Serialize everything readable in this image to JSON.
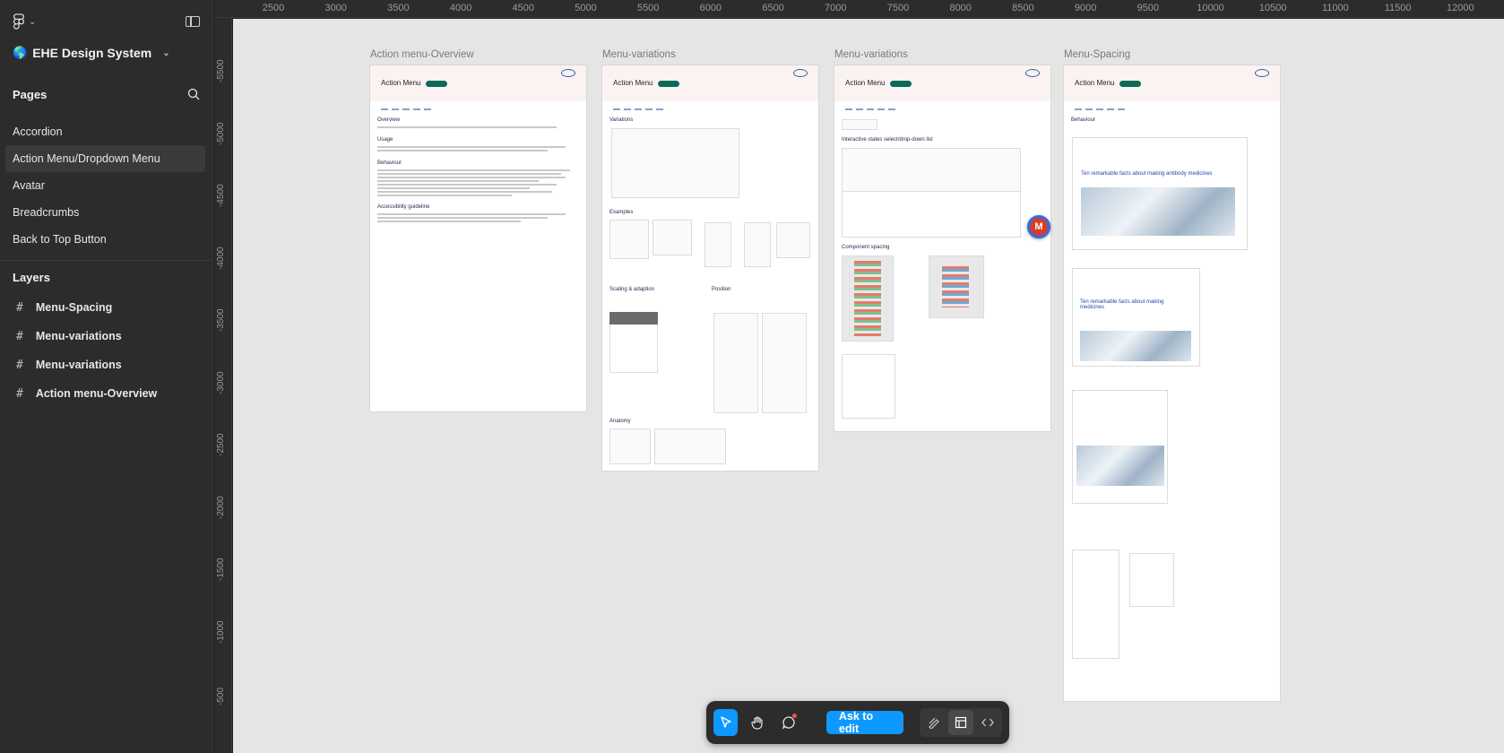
{
  "file": {
    "name": "EHE Design System",
    "emoji": "🌎"
  },
  "sidebar": {
    "pages_heading": "Pages",
    "pages": [
      {
        "label": "Accordion"
      },
      {
        "label": "Action Menu/Dropdown Menu"
      },
      {
        "label": "Avatar"
      },
      {
        "label": "Breadcrumbs"
      },
      {
        "label": "Back to Top Button"
      }
    ],
    "active_page": "Action Menu/Dropdown Menu",
    "layers_heading": "Layers",
    "layers": [
      {
        "label": "Menu-Spacing"
      },
      {
        "label": "Menu-variations"
      },
      {
        "label": "Menu-variations"
      },
      {
        "label": "Action menu-Overview"
      }
    ]
  },
  "ruler": {
    "x_ticks": [
      "2500",
      "3000",
      "3500",
      "4000",
      "4500",
      "5000",
      "5500",
      "6000",
      "6500",
      "7000",
      "7500",
      "8000",
      "8500",
      "9000",
      "9500",
      "10000",
      "10500",
      "11000",
      "11500",
      "12000"
    ],
    "y_ticks": [
      "-5500",
      "-5000",
      "-4500",
      "-4000",
      "-3500",
      "-3000",
      "-2500",
      "-2000",
      "-1500",
      "-1000",
      "-500"
    ]
  },
  "frames": [
    {
      "label": "Action menu-Overview",
      "heading": "Action Menu",
      "sections": [
        "Overview",
        "Usage",
        "Behaviour",
        "Accessibility guideline"
      ]
    },
    {
      "label": "Menu-variations",
      "heading": "Action Menu",
      "sections": [
        "Variations",
        "Examples",
        "Scaling & adaption",
        "Position",
        "Anatomy"
      ]
    },
    {
      "label": "Menu-variations",
      "heading": "Action Menu",
      "sections": [
        "Interactive states select/drop-down list",
        "Component spacing"
      ]
    },
    {
      "label": "Menu-Spacing",
      "heading": "Action Menu",
      "sections": [
        "Behaviour"
      ],
      "article_title": "Ten remarkable facts about making antibody medicines",
      "article_title_short": "Ten remarkable facts about making medicines"
    }
  ],
  "collaborator": {
    "initial": "M",
    "color": "#d93b2b",
    "ring": "#2a6ee8"
  },
  "toolbar": {
    "ask_label": "Ask to edit",
    "tools": [
      "move-icon",
      "hand-icon",
      "comment-icon"
    ],
    "modes": [
      "draw-icon",
      "design-icon",
      "code-icon"
    ]
  },
  "colors": {
    "accent": "#0d99ff",
    "canvas": "#e5e5e5",
    "sidebar": "#2c2c2c"
  }
}
